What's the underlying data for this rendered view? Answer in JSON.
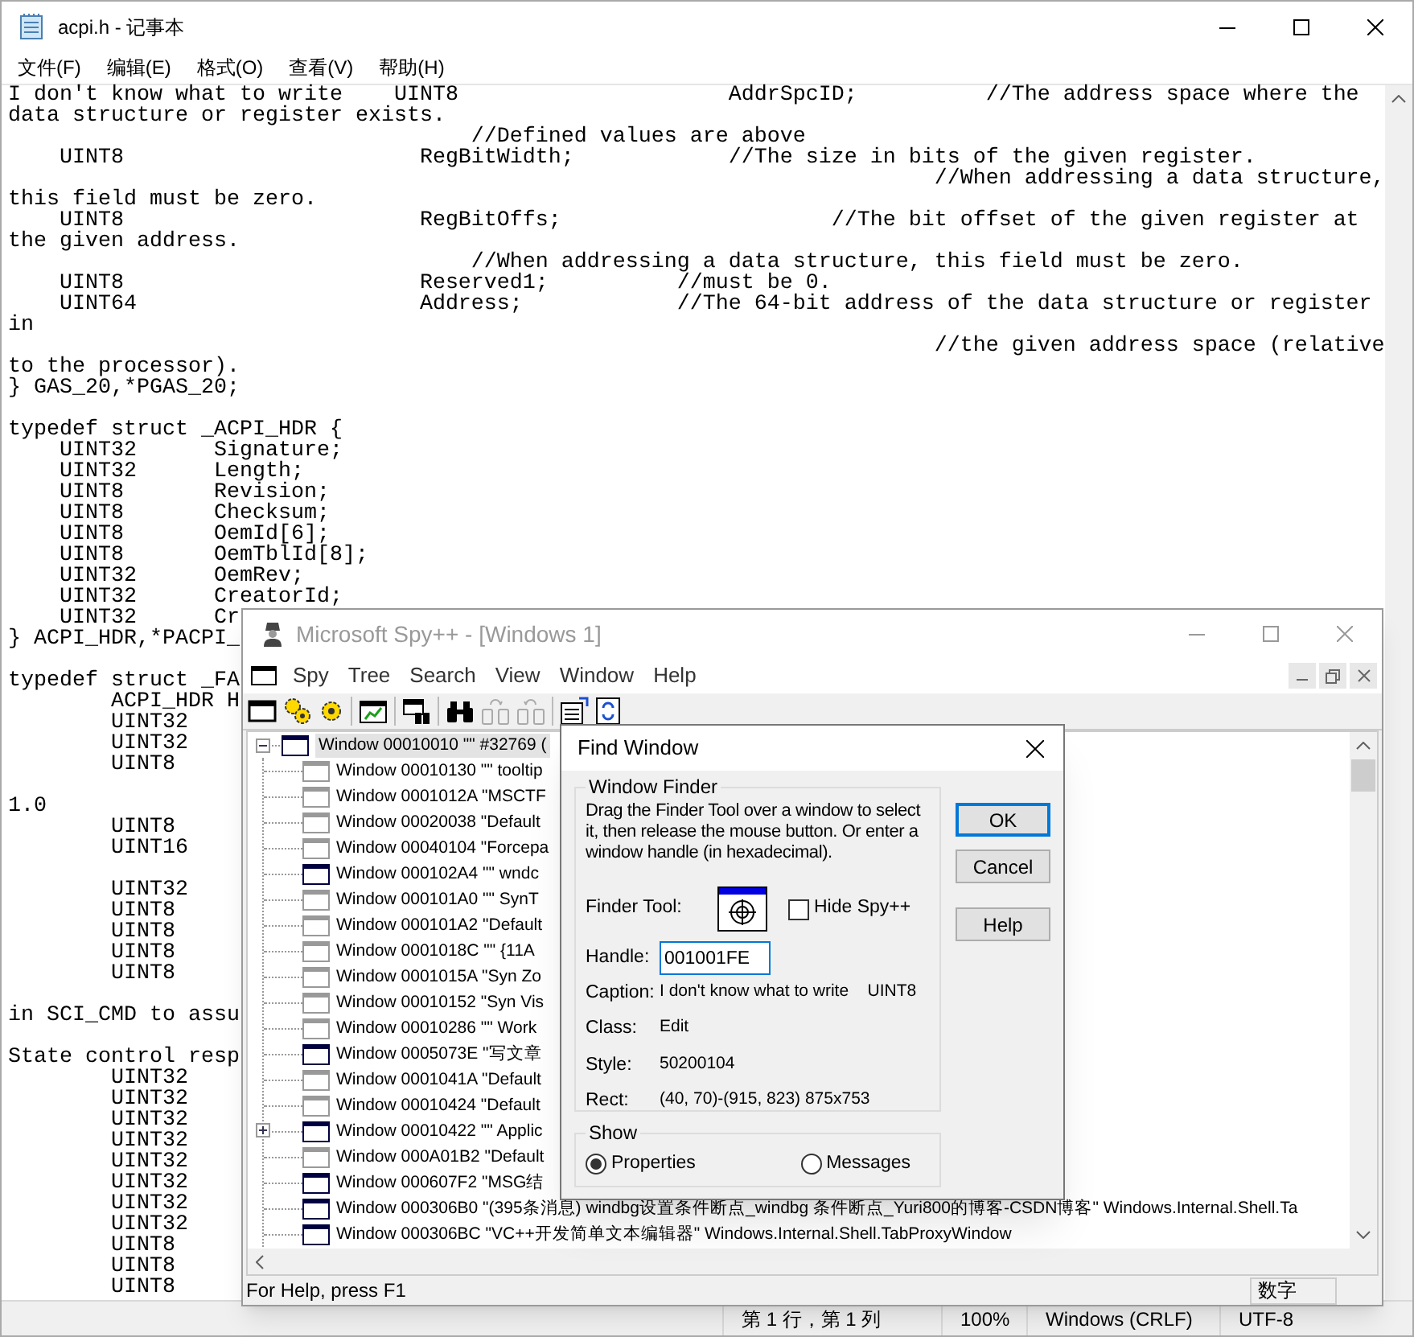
{
  "notepad": {
    "title": "acpi.h - 记事本",
    "menu": [
      "文件(F)",
      "编辑(E)",
      "格式(O)",
      "查看(V)",
      "帮助(H)"
    ],
    "text": "I don't know what to write    UINT8                     AddrSpcID;          //The address space where the\ndata structure or register exists.\n                                    //Defined values are above\n    UINT8                       RegBitWidth;            //The size in bits of the given register.\n                                                                        //When addressing a data structure,\nthis field must be zero.\n    UINT8                       RegBitOffs;                     //The bit offset of the given register at\nthe given address.\n                                    //When addressing a data structure, this field must be zero.\n    UINT8                       Reserved1;          //must be 0.\n    UINT64                      Address;            //The 64-bit address of the data structure or register\nin\n                                                                        //the given address space (relative\nto the processor).\n} GAS_20,*PGAS_20;\n\ntypedef struct _ACPI_HDR {\n    UINT32      Signature;\n    UINT32      Length;\n    UINT8       Revision;\n    UINT8       Checksum;\n    UINT8       OemId[6];\n    UINT8       OemTblId[8];\n    UINT32      OemRev;\n    UINT32      CreatorId;\n    UINT32      Cr\n} ACPI_HDR,*PACPI_\n\ntypedef struct _FA\n        ACPI_HDR H\n        UINT32\n        UINT32\n        UINT8\n\n1.0\n        UINT8\n        UINT16\n\n        UINT32\n        UINT8\n        UINT8\n        UINT8\n        UINT8\n\nin SCI_CMD to assu\n\nState control resp\n        UINT32\n        UINT32\n        UINT32\n        UINT32\n        UINT32\n        UINT32\n        UINT32\n        UINT32\n        UINT8\n        UINT8\n        UINT8",
    "status_bar": {
      "position": "第 1 行，第 1 列",
      "zoom": "100%",
      "line_ending": "Windows (CRLF)",
      "encoding": "UTF-8"
    }
  },
  "spy": {
    "title": "Microsoft Spy++ - [Windows 1]",
    "menu": [
      "Spy",
      "Tree",
      "Search",
      "View",
      "Window",
      "Help"
    ],
    "tree": {
      "text": "Window 00010010 \"\" #32769 (",
      "visible": true,
      "selected": true,
      "expanded": true,
      "children": [
        {
          "text": "Window 00010130 \"\" tooltip",
          "visible": false,
          "selected": false
        },
        {
          "text": "Window 0001012A \"MSCTF",
          "visible": false,
          "selected": false
        },
        {
          "text": "Window 00020038 \"Default",
          "visible": false,
          "selected": false
        },
        {
          "text": "Window 00040104 \"Forcepa",
          "visible": false,
          "selected": false
        },
        {
          "text": "Window 000102A4 \"\" wndc",
          "visible": true,
          "selected": false
        },
        {
          "text": "Window 000101A0 \"\" SynT",
          "visible": false,
          "selected": false
        },
        {
          "text": "Window 000101A2 \"Default",
          "visible": false,
          "selected": false
        },
        {
          "text": "Window 0001018C \"\" {11A",
          "visible": false,
          "selected": false
        },
        {
          "text": "Window 0001015A \"Syn Zo",
          "visible": false,
          "selected": false
        },
        {
          "text": "Window 00010152 \"Syn Vis",
          "visible": false,
          "selected": false
        },
        {
          "text": "Window 00010286 \"\" Work",
          "visible": false,
          "selected": false
        },
        {
          "text": "Window 0005073E \"写文章",
          "visible": true,
          "selected": false
        },
        {
          "text": "Window 0001041A \"Default",
          "visible": false,
          "selected": false
        },
        {
          "text": "Window 00010424 \"Default",
          "visible": false,
          "selected": false
        },
        {
          "text": "Window 00010422 \"\" Applic",
          "visible": true,
          "selected": false,
          "expanded": false
        },
        {
          "text": "Window 000A01B2 \"Default",
          "visible": false,
          "selected": false
        },
        {
          "text": "Window 000607F2 \"MSG结",
          "visible": true,
          "selected": false
        },
        {
          "text": "Window 000306B0 \"(395条消息) windbg设置条件断点_windbg 条件断点_Yuri800的博客-CSDN博客\" Windows.Internal.Shell.Ta",
          "visible": true,
          "selected": false
        },
        {
          "text": "Window 000306BC \"VC++开发简单文本编辑器\" Windows.Internal.Shell.TabProxyWindow",
          "visible": true,
          "selected": false
        }
      ]
    },
    "status_bar": {
      "message": "For Help, press F1",
      "indicator": "数字"
    }
  },
  "find_dialog": {
    "title": "Find Window",
    "finder_group": {
      "title": "Window Finder",
      "instructions": "Drag the Finder Tool over a window to select it, then release the mouse button.  Or enter a window handle (in hexadecimal).",
      "finder_label": "Finder Tool:",
      "hide_spy": {
        "label": "Hide Spy++",
        "checked": false
      },
      "handle": {
        "label": "Handle:",
        "value": "001001FE"
      },
      "properties": [
        {
          "label": "Caption:",
          "value": "I don't know what to write    UINT8"
        },
        {
          "label": "Class:",
          "value": "Edit"
        },
        {
          "label": "Style:",
          "value": "50200104"
        },
        {
          "label": "Rect:",
          "value": "(40, 70)-(915, 823) 875x753"
        }
      ]
    },
    "show_group": {
      "title": "Show",
      "options": [
        {
          "label": "Properties",
          "selected": true
        },
        {
          "label": "Messages",
          "selected": false
        }
      ]
    },
    "buttons": [
      {
        "label": "OK",
        "default": true
      },
      {
        "label": "Cancel",
        "default": false
      },
      {
        "label": "Help",
        "default": false
      }
    ]
  }
}
